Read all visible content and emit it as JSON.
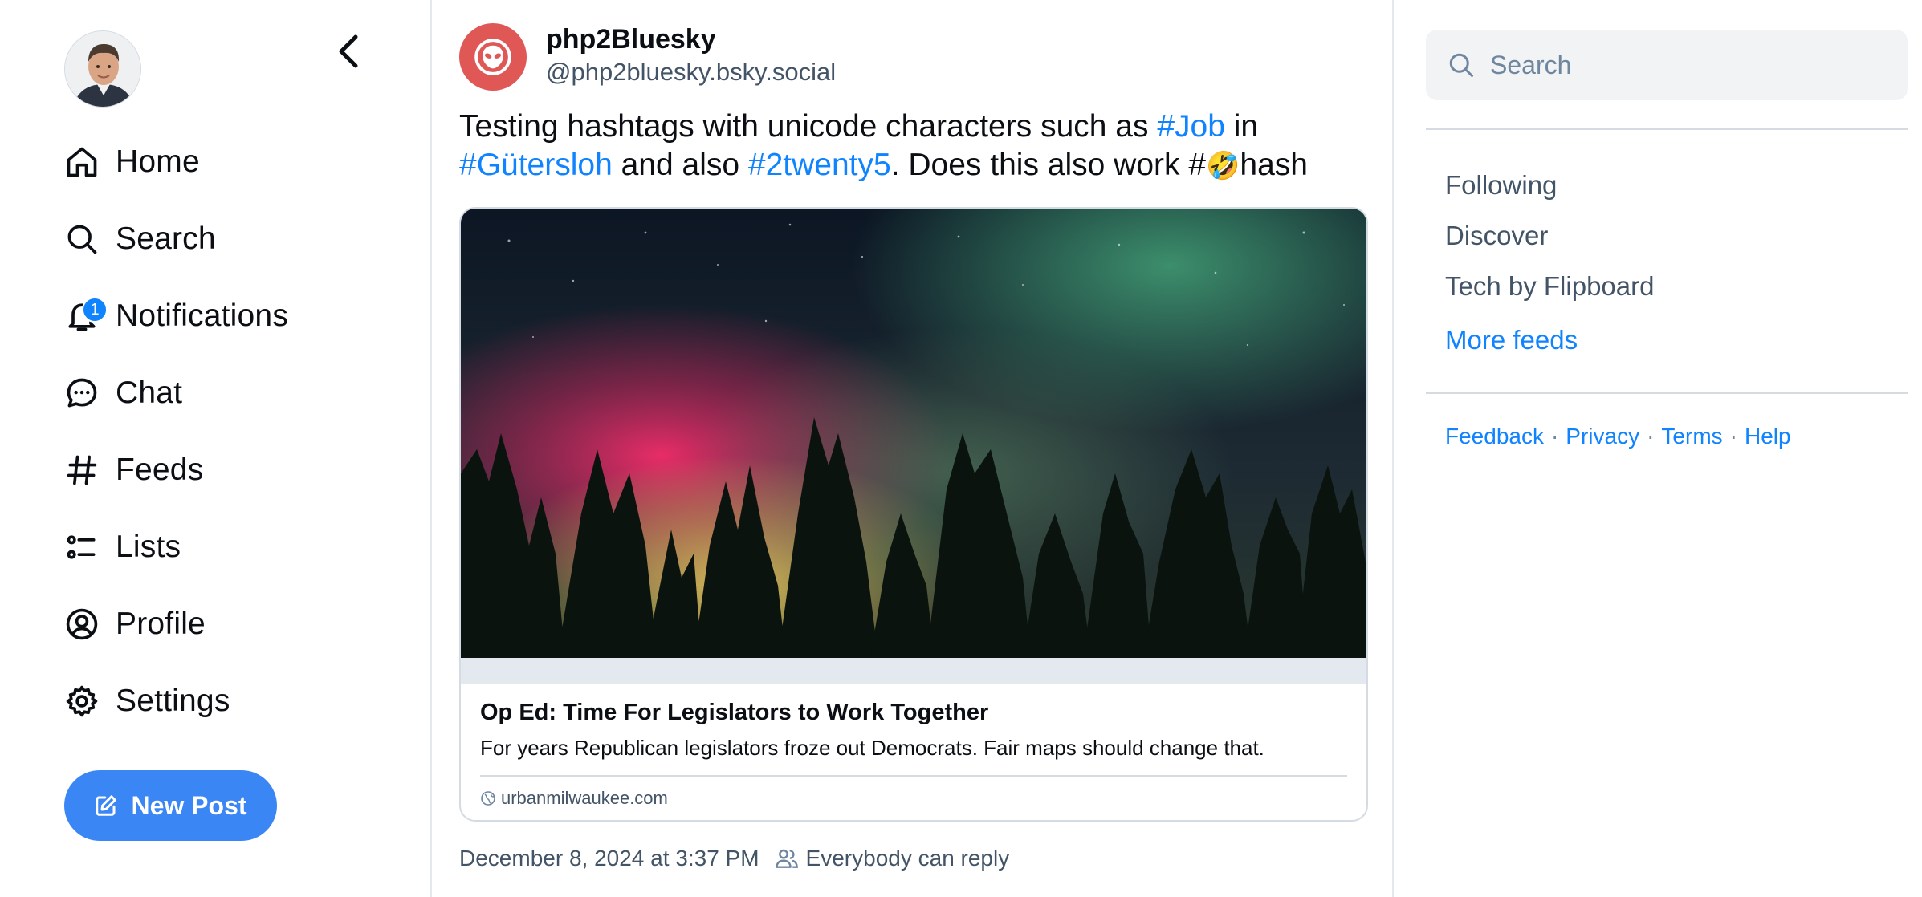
{
  "nav": {
    "items": [
      {
        "label": "Home",
        "icon": "home-icon"
      },
      {
        "label": "Search",
        "icon": "search-icon"
      },
      {
        "label": "Notifications",
        "icon": "bell-icon",
        "badge": "1"
      },
      {
        "label": "Chat",
        "icon": "chat-bubble-icon"
      },
      {
        "label": "Feeds",
        "icon": "hash-icon"
      },
      {
        "label": "Lists",
        "icon": "list-icon"
      },
      {
        "label": "Profile",
        "icon": "user-circle-icon"
      },
      {
        "label": "Settings",
        "icon": "gear-icon"
      }
    ],
    "new_post_label": "New Post"
  },
  "post": {
    "display_name": "php2Bluesky",
    "handle": "@php2bluesky.bsky.social",
    "text": {
      "t1": "Testing hashtags with unicode characters such as ",
      "tag1": "#Job",
      "t2": " in",
      "tag2": "#Gütersloh",
      "t3": " and also ",
      "tag3": "#2twenty5",
      "t4": ". Does this also work #",
      "emoji": "🤣",
      "t5": "hash"
    },
    "embed": {
      "title": "Op Ed: Time For Legislators to Work Together",
      "description": "For years Republican legislators froze out Democrats. Fair maps should change that.",
      "domain": "urbanmilwaukee.com"
    },
    "timestamp": "December 8, 2024 at 3:37 PM",
    "reply_setting": "Everybody can reply"
  },
  "right": {
    "search_placeholder": "Search",
    "feeds": [
      "Following",
      "Discover",
      "Tech by Flipboard"
    ],
    "more_feeds": "More feeds",
    "footer": [
      "Feedback",
      "Privacy",
      "Terms",
      "Help"
    ]
  },
  "colors": {
    "accent": "#1083fe",
    "button": "#3a86f5",
    "avatar_bg": "#e05856",
    "muted": "#425466"
  }
}
